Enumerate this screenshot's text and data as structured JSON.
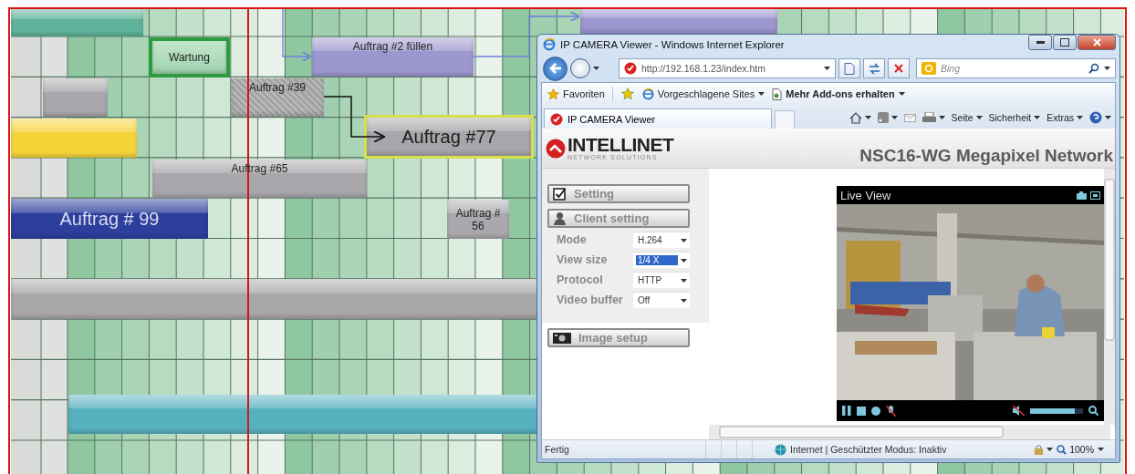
{
  "schedule": {
    "bars": [
      {
        "color": "#5fb39a",
        "kind": "plain",
        "selected": false
      },
      {
        "color": "#9d97d0",
        "kind": "plain",
        "selected": false
      },
      {
        "label": "Wartung",
        "color": "#2e9b3e",
        "kind": "outlined",
        "selected": false
      },
      {
        "label": "Auftrag #2 füllen",
        "color": "#9d97d0",
        "kind": "plain",
        "selected": false
      },
      {
        "color": "#a9a7ab",
        "kind": "plain",
        "selected": false
      },
      {
        "label": "Auftrag #39",
        "color": "#a3a3a3",
        "kind": "hatched",
        "selected": false
      },
      {
        "color": "#f5d43a",
        "kind": "plain",
        "selected": false
      },
      {
        "label": "Auftrag #77",
        "color": "#a8a6aa",
        "kind": "plain",
        "selected": true
      },
      {
        "label": "Auftrag #65",
        "color": "#a9a7ab",
        "kind": "plain",
        "selected": false
      },
      {
        "label": "Auftrag # 99",
        "color": "#2d3f9c",
        "kind": "plain",
        "selected": false
      },
      {
        "label": "Auftrag # 56",
        "color": "#aaa8ac",
        "kind": "plain",
        "selected": false
      },
      {
        "color": "#a9a7aa",
        "kind": "plain",
        "selected": false
      },
      {
        "color": "#56b1bf",
        "kind": "plain",
        "selected": false
      }
    ]
  },
  "browser": {
    "title": "IP CAMERA Viewer - Windows Internet Explorer",
    "address": "http://192.168.1.23/index.htm",
    "search": {
      "placeholder": "Bing"
    },
    "favorites": [
      {
        "label": "Favoriten",
        "kind": "favorites"
      },
      {
        "label": "Vorgeschlagene Sites",
        "kind": "sites"
      },
      {
        "label": "Mehr Add-ons erhalten",
        "kind": "addons"
      }
    ],
    "tab": {
      "title": "IP CAMERA Viewer"
    },
    "commands": [
      "Seite",
      "Sicherheit",
      "Extras"
    ],
    "page": {
      "logo": "INTELLINET",
      "tagline": "NETWORK SOLUTIONS",
      "heading": "NSC16-WG Megapixel Network",
      "menu": [
        {
          "label": "Setting",
          "kind": "check"
        },
        {
          "label": "Client setting",
          "kind": "user"
        }
      ],
      "settings": [
        {
          "label": "Mode",
          "value": "H.264",
          "focused": false
        },
        {
          "label": "View size",
          "value": "1/4 X",
          "focused": true
        },
        {
          "label": "Protocol",
          "value": "HTTP",
          "focused": false
        },
        {
          "label": "Video buffer",
          "value": "Off",
          "focused": false
        }
      ],
      "image_setup": {
        "label": "Image setup",
        "kind": "camera"
      },
      "live_view": {
        "title": "Live View",
        "volume": {
          "level": 0.85
        }
      }
    },
    "status": {
      "text": "Fertig",
      "zone": "Internet | Geschützter Modus: Inaktiv",
      "zoom": "100%"
    }
  }
}
